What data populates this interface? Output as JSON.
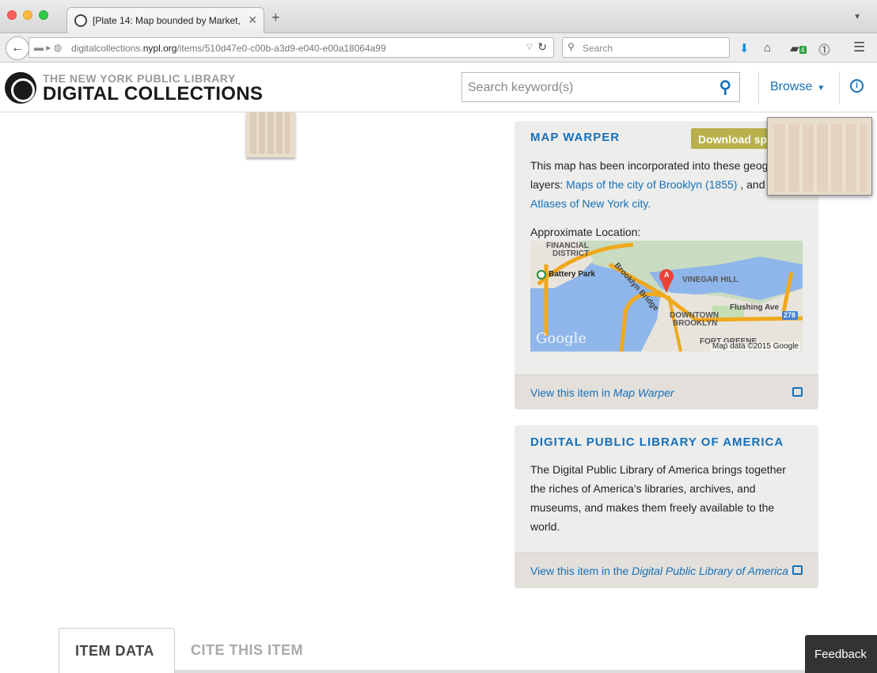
{
  "browser": {
    "tab_title": "[Plate 14: Map bounded by Market, ...",
    "url_domain_prefix": "digitalcollections.",
    "url_domain_main": "nypl.org",
    "url_path": "/items/510d47e0-c00b-a3d9-e040-e00a18064a99",
    "search_placeholder": "Search",
    "badge_count": "4"
  },
  "header": {
    "logo_top": "THE NEW YORK PUBLIC LIBRARY",
    "logo_main": "DIGITAL COLLECTIONS",
    "search_placeholder": "Search keyword(s)",
    "browse_label": "Browse",
    "info_label": "i"
  },
  "map_warper": {
    "title": "MAP WARPER",
    "download_label": "Download spa",
    "text_before": "This map has been incorporated into these geog",
    "text_layers": "layers: ",
    "link1": "Maps of the city of Brooklyn (1855)",
    "text_and": " , and",
    "link2": "Atlases of New York city.",
    "location_label": "Approximate Location:",
    "map_labels": {
      "financial": "FINANCIAL",
      "district": "DISTRICT",
      "battery": "Battery Park",
      "bridge": "Brooklyn Bridge",
      "vinegar": "VINEGAR HILL",
      "flushing": "Flushing Ave",
      "downtown": "DOWNTOWN",
      "brooklyn": "BROOKLYN",
      "fort": "FORT GREENE",
      "route": "278",
      "marker": "A",
      "google": "Google",
      "mapdata": "Map data ©2015 Google"
    },
    "footer_prefix": "View this item in ",
    "footer_link": "Map Warper"
  },
  "dpla": {
    "title": "DIGITAL PUBLIC LIBRARY OF AMERICA",
    "line1": "The Digital Public Library of America brings together",
    "line2": "the riches of America’s libraries, archives, and",
    "line3": "museums, and makes them freely available to the",
    "line4": "world.",
    "footer_prefix": "View this item in the ",
    "footer_link": "Digital Public Library of America"
  },
  "tabs": {
    "item_data": "ITEM DATA",
    "cite": "CITE THIS ITEM"
  },
  "feedback": "Feedback"
}
